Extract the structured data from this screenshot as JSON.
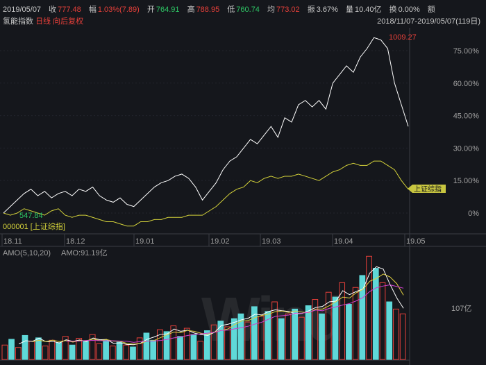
{
  "header": {
    "date": "2019/05/07",
    "close_label": "收",
    "close": "777.48",
    "chg_label": "幅",
    "chg": "1.03%(7.89)",
    "open_label": "开",
    "open": "764.91",
    "high_label": "高",
    "high": "788.95",
    "low_label": "低",
    "low": "760.74",
    "avg_label": "均",
    "avg": "773.02",
    "amp_label": "振",
    "amp": "3.67%",
    "vol_label": "量",
    "vol": "10.40亿",
    "turn_label": "换",
    "turn": "0.00%",
    "amt_label": "额"
  },
  "subheader": {
    "name": "氢能指数",
    "period": "日线",
    "adjust": "向后复权",
    "range": "2018/11/07-2019/05/07(119日)"
  },
  "colors": {
    "bg": "#15171c",
    "main": "#ffffff",
    "bench": "#d4d23a",
    "red": "#e8403a",
    "cyan": "#5fd8d8",
    "ma5": "#ffffff",
    "ma10": "#e0d040",
    "ma20": "#d040d0"
  },
  "chart_data": [
    {
      "type": "line",
      "title": "氢能指数 vs 000001 [上证综指]",
      "y_ticks": [
        "75.00%",
        "60.00%",
        "45.00%",
        "30.00%",
        "15.00%",
        "0%"
      ],
      "y_tick_values": [
        75,
        60,
        45,
        30,
        15,
        0
      ],
      "x_ticks": [
        "18.11",
        "18.12",
        "19.01",
        "19.02",
        "19.03",
        "19.04",
        "19.05"
      ],
      "max_label": "1009.27",
      "start_label": "547.84",
      "bench_label": "上证综指",
      "legend": "000001 [上证综指]",
      "series": [
        {
          "name": "氢能指数",
          "values": [
            0,
            3,
            6,
            9,
            11,
            8,
            10,
            7,
            9,
            10,
            8,
            11,
            10,
            12,
            8,
            6,
            5,
            7,
            4,
            3,
            6,
            9,
            12,
            14,
            15,
            17,
            18,
            16,
            12,
            6,
            10,
            14,
            20,
            24,
            26,
            30,
            34,
            32,
            36,
            40,
            35,
            44,
            42,
            50,
            52,
            49,
            52,
            48,
            60,
            64,
            68,
            65,
            72,
            76,
            81,
            80,
            76,
            60,
            50,
            40
          ]
        },
        {
          "name": "000001 上证综指",
          "values": [
            0,
            -1,
            0,
            2,
            1,
            0,
            -1,
            1,
            2,
            -1,
            -2,
            -1,
            -1,
            -2,
            -3,
            -4,
            -4,
            -5,
            -6,
            -6,
            -4,
            -4,
            -3,
            -3,
            -2,
            -2,
            -2,
            -1,
            -1,
            -1,
            1,
            3,
            6,
            9,
            11,
            12,
            15,
            14,
            16,
            17,
            16,
            17,
            17,
            18,
            17,
            16,
            15,
            17,
            19,
            20,
            22,
            23,
            22,
            22,
            24,
            24,
            22,
            20,
            15,
            11
          ]
        }
      ]
    },
    {
      "type": "bar",
      "title": "AMO(5,10,20)",
      "value_label": "AMO:91.19亿",
      "y_tick": "107亿",
      "unit": "亿",
      "values": [
        30,
        42,
        25,
        50,
        38,
        45,
        28,
        40,
        35,
        48,
        30,
        44,
        38,
        52,
        33,
        40,
        28,
        36,
        30,
        26,
        45,
        55,
        40,
        62,
        58,
        70,
        48,
        65,
        52,
        38,
        60,
        72,
        80,
        68,
        85,
        95,
        78,
        110,
        90,
        100,
        120,
        85,
        95,
        105,
        88,
        112,
        125,
        95,
        140,
        130,
        160,
        115,
        150,
        175,
        215,
        190,
        160,
        120,
        105,
        95
      ],
      "colors": [
        "r",
        "c",
        "r",
        "c",
        "r",
        "c",
        "r",
        "r",
        "c",
        "r",
        "c",
        "r",
        "c",
        "r",
        "r",
        "c",
        "r",
        "c",
        "r",
        "c",
        "r",
        "c",
        "c",
        "r",
        "c",
        "r",
        "c",
        "r",
        "c",
        "r",
        "c",
        "r",
        "c",
        "r",
        "c",
        "c",
        "r",
        "c",
        "r",
        "c",
        "r",
        "c",
        "r",
        "c",
        "r",
        "c",
        "r",
        "c",
        "r",
        "c",
        "r",
        "c",
        "r",
        "c",
        "r",
        "c",
        "r",
        "c",
        "r",
        "r"
      ]
    }
  ]
}
